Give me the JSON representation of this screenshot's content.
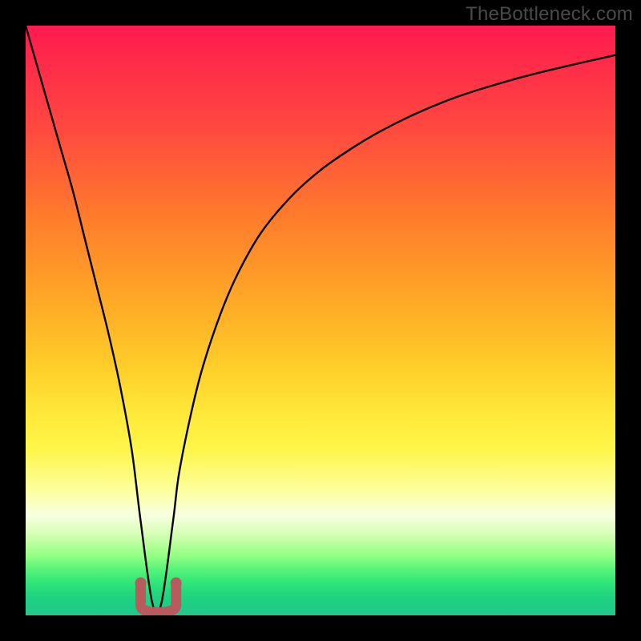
{
  "watermark": "TheBottleneck.com",
  "colors": {
    "frame": "#000000",
    "watermark": "#4a4a4a",
    "curve_stroke": "#000000",
    "marker_stroke": "#b85a5e",
    "marker_fill": "#b85a5e"
  },
  "chart_data": {
    "type": "line",
    "title": "",
    "xlabel": "",
    "ylabel": "",
    "xlim": [
      0,
      100
    ],
    "ylim": [
      0,
      100
    ],
    "grid": false,
    "legend": false,
    "series": [
      {
        "name": "curve",
        "x": [
          0,
          2,
          4,
          6,
          8,
          10,
          12,
          14,
          16,
          18,
          19.5,
          21.5,
          23,
          25,
          26,
          28,
          30,
          33,
          36,
          40,
          45,
          50,
          55,
          60,
          66,
          72,
          78,
          85,
          92,
          100
        ],
        "y": [
          100,
          93,
          86,
          79,
          72,
          64,
          56,
          48,
          39,
          28,
          16,
          2,
          2,
          16,
          24,
          34,
          42,
          51,
          58,
          65,
          71,
          75.5,
          79,
          82,
          85,
          87.5,
          89.5,
          91.5,
          93.2,
          95
        ]
      }
    ],
    "annotations": [
      {
        "name": "valley-marker",
        "shape": "U",
        "x_range": [
          19.5,
          25.5
        ],
        "y_range": [
          0.5,
          5.5
        ]
      }
    ]
  }
}
